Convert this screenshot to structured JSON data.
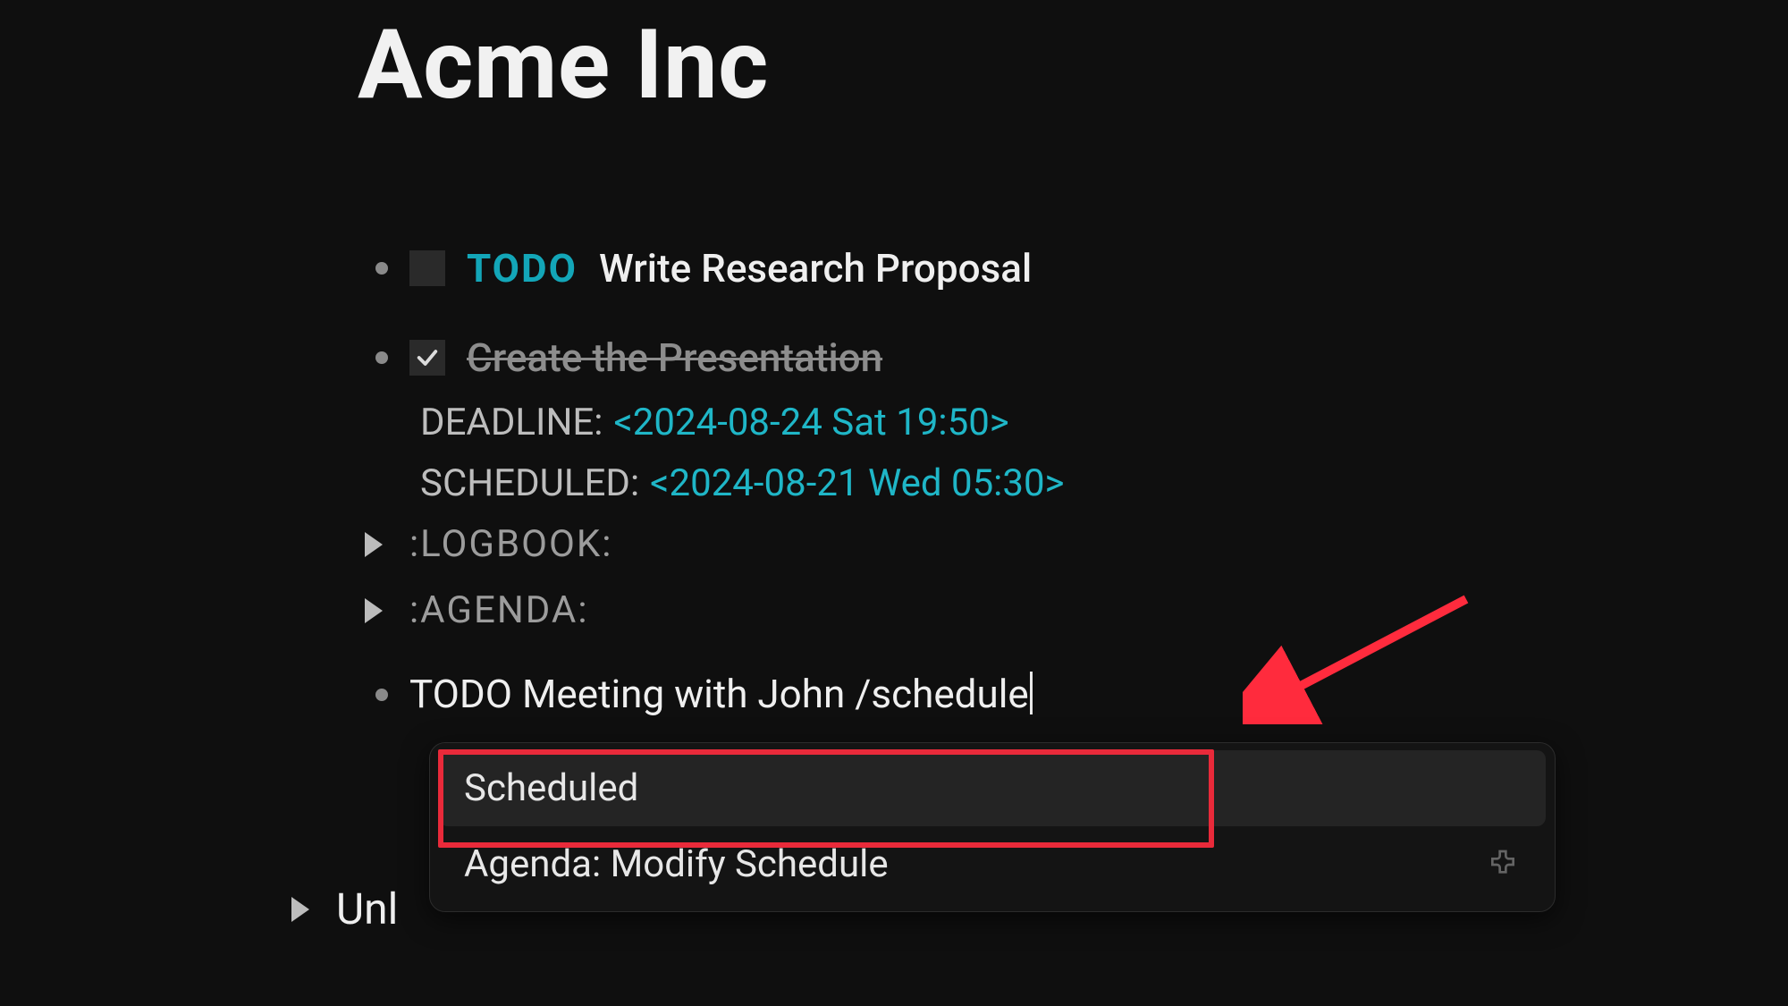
{
  "title": "Acme Inc",
  "tasks": [
    {
      "keyword": "TODO",
      "text": "Write Research Proposal",
      "done": false
    },
    {
      "keyword": "",
      "text": "Create the Presentation",
      "done": true,
      "deadline_label": "DEADLINE:",
      "deadline_ts": "<2024-08-24 Sat 19:50>",
      "scheduled_label": "SCHEDULED:",
      "scheduled_ts": "<2024-08-21 Wed 05:30>"
    }
  ],
  "drawers": [
    ":LOGBOOK:",
    ":AGENDA:"
  ],
  "editing_line": "TODO Meeting with John /schedule",
  "popup": {
    "items": [
      "Scheduled",
      "Agenda: Modify Schedule"
    ]
  },
  "bottom_fragment": "Unl"
}
